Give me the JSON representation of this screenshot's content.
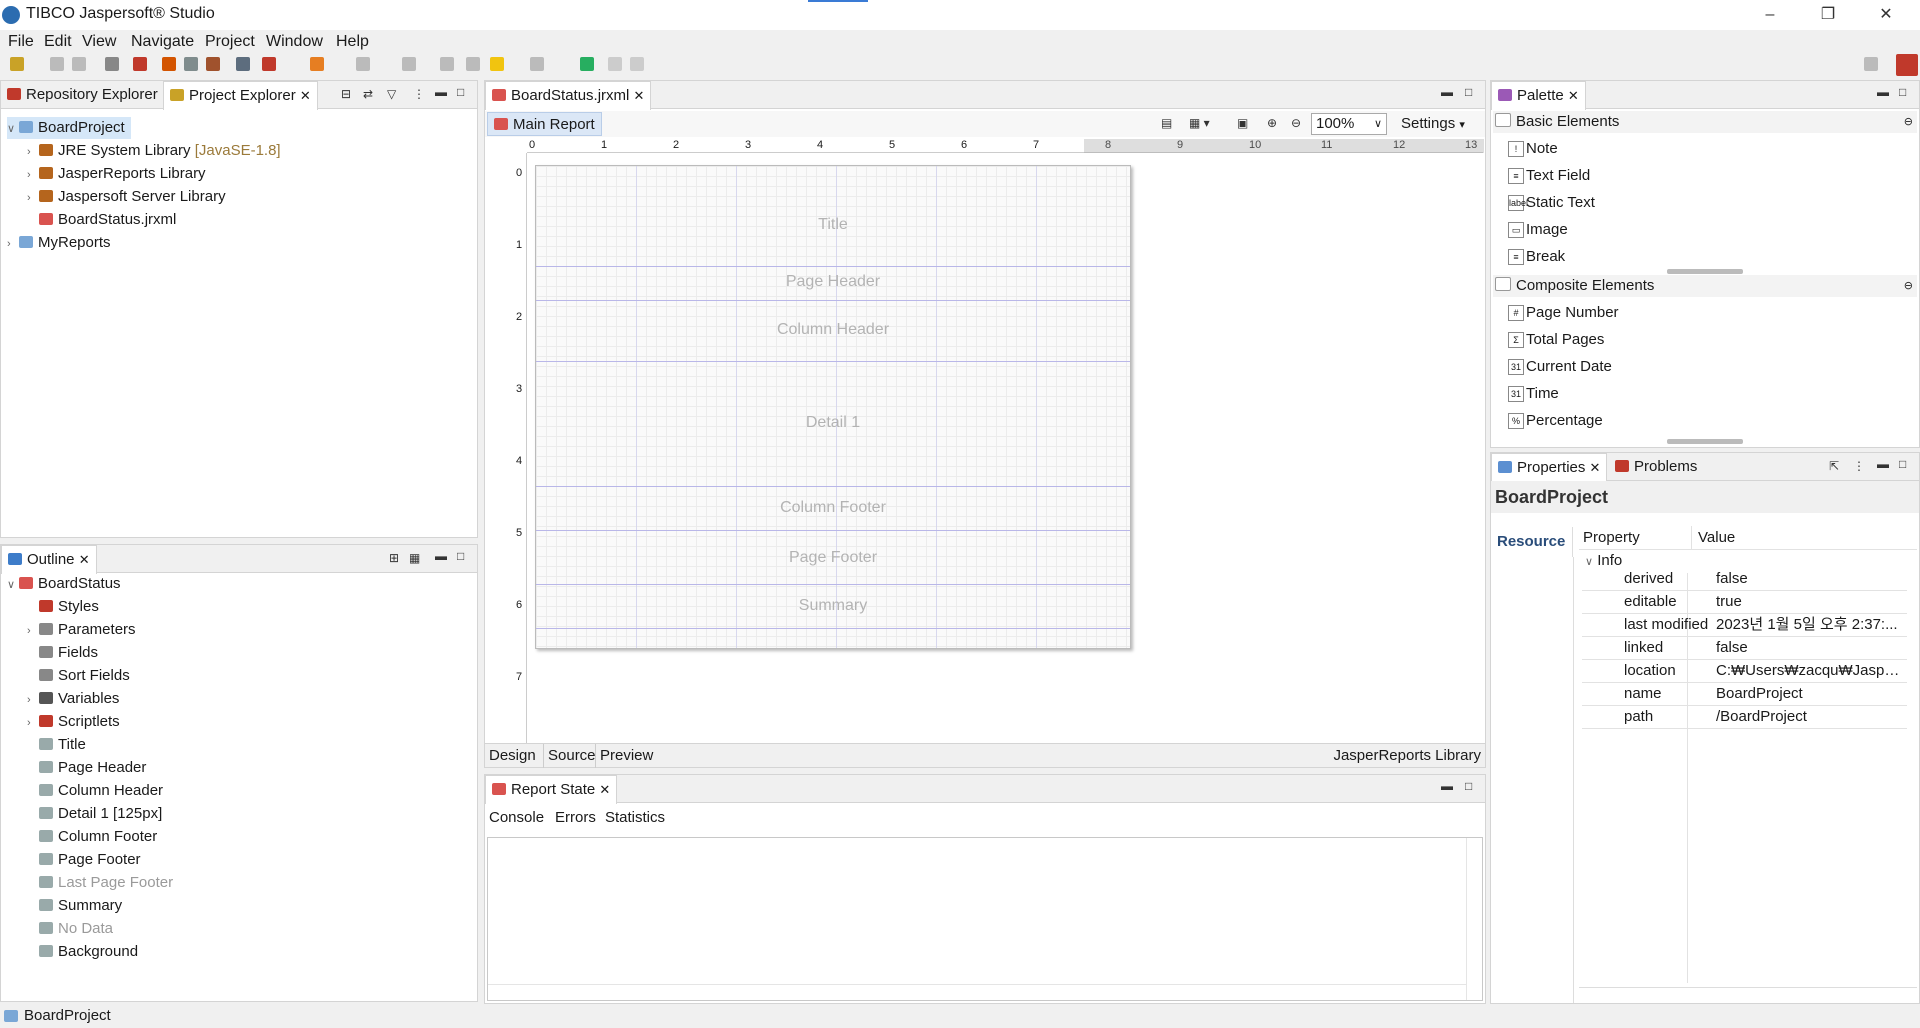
{
  "window": {
    "title": "TIBCO Jaspersoft® Studio"
  },
  "menu": [
    "File",
    "Edit",
    "View",
    "Navigate",
    "Project",
    "Window",
    "Help"
  ],
  "explorer": {
    "tabs": [
      "Repository Explorer",
      "Project Explorer"
    ],
    "project": "BoardProject",
    "items": [
      {
        "label": "JRE System Library",
        "suffix": "[JavaSE-1.8]"
      },
      {
        "label": "JasperReports Library"
      },
      {
        "label": "Jaspersoft Server Library"
      },
      {
        "label": "BoardStatus.jrxml"
      }
    ],
    "other_project": "MyReports"
  },
  "outline": {
    "tab": "Outline",
    "root": "BoardStatus",
    "items": [
      "Styles",
      "Parameters",
      "Fields",
      "Sort Fields",
      "Variables",
      "Scriptlets",
      "Title",
      "Page Header",
      "Column Header",
      "Detail 1 [125px]",
      "Column Footer",
      "Page Footer",
      "Last Page Footer",
      "Summary",
      "No Data",
      "Background"
    ]
  },
  "editor": {
    "tab": "BoardStatus.jrxml",
    "subtab": "Main Report",
    "zoom": "100%",
    "settings": "Settings",
    "ruler": [
      "0",
      "1",
      "2",
      "3",
      "4",
      "5",
      "6",
      "7",
      "8",
      "9",
      "10",
      "11",
      "12",
      "13"
    ],
    "vruler": [
      "0",
      "1",
      "2",
      "3",
      "4",
      "5",
      "6",
      "7"
    ],
    "bands": [
      "Title",
      "Page Header",
      "Column Header",
      "Detail 1",
      "Column Footer",
      "Page Footer",
      "Summary"
    ],
    "bottom_tabs": [
      "Design",
      "Source",
      "Preview"
    ],
    "library": "JasperReports Library"
  },
  "report_state": {
    "tab": "Report State",
    "subtabs": [
      "Console",
      "Errors",
      "Statistics"
    ]
  },
  "palette": {
    "tab": "Palette",
    "basic_header": "Basic Elements",
    "basic": [
      "Note",
      "Text Field",
      "Static Text",
      "Image",
      "Break"
    ],
    "composite_header": "Composite Elements",
    "composite": [
      "Page Number",
      "Total Pages",
      "Current Date",
      "Time",
      "Percentage"
    ],
    "icons": [
      "!",
      "≡",
      "label",
      "▭",
      "≡",
      "#",
      "Σ",
      "31",
      "31",
      "%"
    ]
  },
  "properties": {
    "tabs": [
      "Properties",
      "Problems"
    ],
    "title": "BoardProject",
    "side_tab": "Resource",
    "col_property": "Property",
    "col_value": "Value",
    "group": "Info",
    "rows": [
      {
        "name": "derived",
        "value": "false"
      },
      {
        "name": "editable",
        "value": "true"
      },
      {
        "name": "last modified",
        "value": "2023년 1월 5일 오후 2:37:..."
      },
      {
        "name": "linked",
        "value": "false"
      },
      {
        "name": "location",
        "value": "C:₩Users₩zacqu₩Jasperso..."
      },
      {
        "name": "name",
        "value": "BoardProject"
      },
      {
        "name": "path",
        "value": "/BoardProject"
      }
    ]
  },
  "status": "BoardProject"
}
